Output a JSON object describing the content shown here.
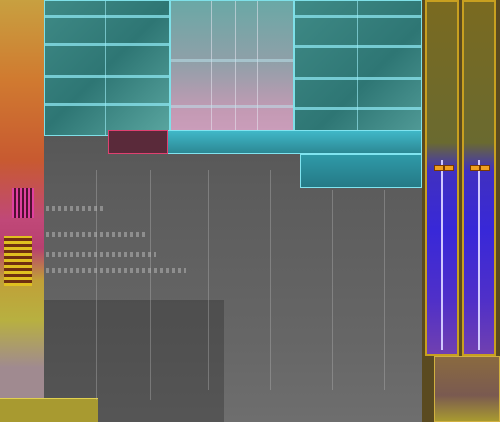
{
  "image": {
    "kind": "chip-die-layout"
  },
  "palette": {
    "background": "#5a5a5a",
    "cache_teal": "#2f8f88",
    "cache_cyan": "#38c0d0",
    "cache_pink": "#c89ab0",
    "left_strip": "#d07a30",
    "left_strip_pink": "#c04080",
    "right_column_blue": "#3a30d0",
    "right_column_border": "#c8a020",
    "bottom_yellow": "#b0a030"
  }
}
